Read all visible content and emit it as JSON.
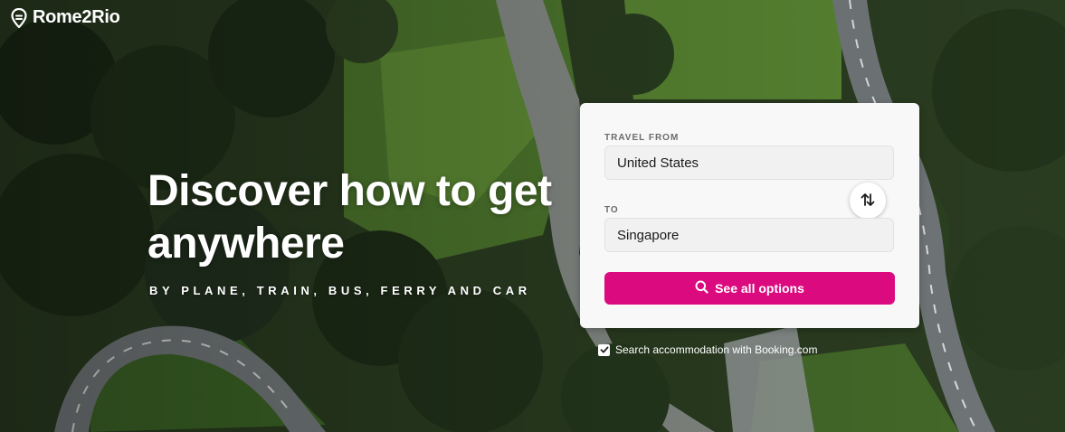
{
  "brand": {
    "name": "Rome2Rio",
    "icon": "location-pin-icon"
  },
  "hero": {
    "headline": "Discover how to get anywhere",
    "tagline": "BY PLANE, TRAIN, BUS, FERRY AND CAR"
  },
  "search": {
    "from_label": "TRAVEL FROM",
    "from_value": "United States",
    "to_label": "TO",
    "to_value": "Singapore",
    "swap_icon": "swap-vertical-icon",
    "button_label": "See all options",
    "button_icon": "search-icon"
  },
  "accommodation": {
    "checked": true,
    "label": "Search accommodation with Booking.com"
  },
  "colors": {
    "accent": "#dc0a7f",
    "card_bg": "#f8f8f8",
    "input_bg": "#f1f1f1"
  }
}
